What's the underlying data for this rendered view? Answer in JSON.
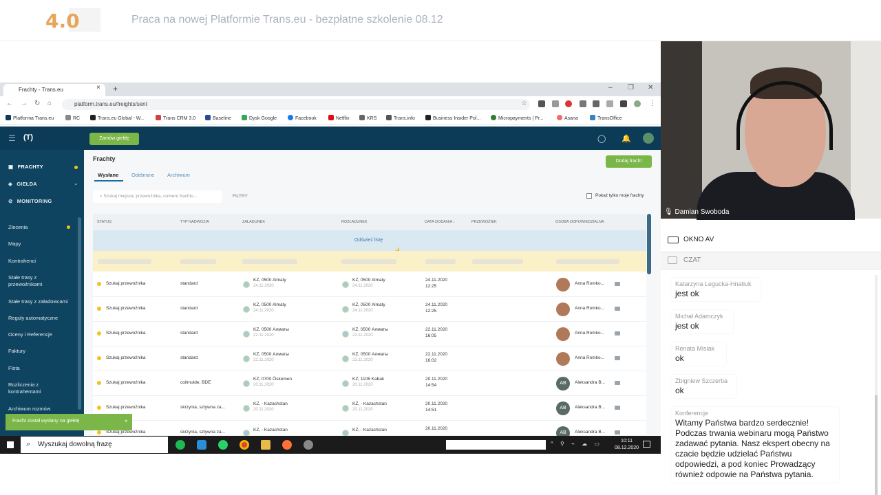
{
  "banner": {
    "logo": "4.0",
    "title": "Praca na nowej Platformie Trans.eu - bezpłatne szkolenie 08.12"
  },
  "browser": {
    "tab_title": "Frachty - Trans.eu",
    "url": "platform.trans.eu/freights/sent",
    "bookmarks": [
      "Platforma Trans.eu",
      "RC",
      "Trans.eu Global - W...",
      "Trans CRM 3.0",
      "Baseline",
      "Dysk Google",
      "Facebook",
      "Netflix",
      "KRS",
      "Trans.info",
      "Business Insider Pol...",
      "Micropayments | Pr...",
      "Asana",
      "TransOffice"
    ]
  },
  "app": {
    "logo": "(T)",
    "order_button": "Zamów giełdę",
    "sidebar_main": [
      "FRACHTY",
      "GIEŁDA",
      "MONITORING"
    ],
    "sidebar_sub": [
      "Zlecenia",
      "Mapy",
      "Kontrahenci",
      "Stałe trasy z przewoźnikami",
      "Stałe trasy z załadowcami",
      "Reguły automatyczne",
      "Oceny i Referencje",
      "Faktury",
      "Flota",
      "Rozliczenia z kontrahentami",
      "Archiwum rozmów"
    ],
    "page_title": "Frachty",
    "add_button": "Dodaj fracht",
    "tabs": [
      "Wysłane",
      "Odebrane",
      "Archiwum"
    ],
    "search_placeholder": "Szukaj miejsca, przewoźnika, numeru frachtu...",
    "filters": "FILTRY",
    "only_mine": "Pokaż tylko moje frachty",
    "columns": [
      "STATUS",
      "TYP NADWOZIA",
      "ZAŁADUNEK",
      "ROZŁADUNEK",
      "DATA DODANIA",
      "PRZEWOŹNIK",
      "OSOBA ODPOWIEDZIALNA"
    ],
    "refresh": "Odśwież listę",
    "rows": [
      {
        "status": "Szukaj przewoźnika",
        "body": "standard",
        "load": "KZ, 0500 Almaty",
        "load_date": "24.11.2020",
        "unload": "KZ, 0500 Almaty",
        "unload_date": "24.11.2020",
        "added": "24.11.2020",
        "time": "12:25",
        "person": "Anna Romko...",
        "avatar": ""
      },
      {
        "status": "Szukaj przewoźnika",
        "body": "standard",
        "load": "KZ, 0500 Almaty",
        "load_date": "24.11.2020",
        "unload": "KZ, 0500 Almaty",
        "unload_date": "24.11.2020",
        "added": "24.11.2020",
        "time": "12:25",
        "person": "Anna Romko...",
        "avatar": ""
      },
      {
        "status": "Szukaj przewoźnika",
        "body": "standard",
        "load": "KZ, 0500 Алматы",
        "load_date": "22.11.2020",
        "unload": "KZ, 0500 Алматы",
        "unload_date": "22.11.2020",
        "added": "22.11.2020",
        "time": "16:05",
        "person": "Anna Romko...",
        "avatar": ""
      },
      {
        "status": "Szukaj przewoźnika",
        "body": "standard",
        "load": "KZ, 0500 Алматы",
        "load_date": "22.11.2020",
        "unload": "KZ, 0500 Алматы",
        "unload_date": "22.11.2020",
        "added": "22.11.2020",
        "time": "16:02",
        "person": "Anna Romko...",
        "avatar": ""
      },
      {
        "status": "Szukaj przewoźnika",
        "body": "coilmulde, BDE",
        "load": "KZ, 0700 Öskemen",
        "load_date": "20.11.2020",
        "unload": "KZ, 1106 Kabak",
        "unload_date": "20.11.2020",
        "added": "20.11.2020",
        "time": "14:54",
        "person": "Aleksandra B...",
        "avatar": "AB"
      },
      {
        "status": "Szukaj przewoźnika",
        "body": "skrzynia, sztywna za...",
        "load": "KZ, - Kazachstan",
        "load_date": "20.11.2020",
        "unload": "KZ, - Kazachstan",
        "unload_date": "20.11.2020",
        "added": "20.11.2020",
        "time": "14:51",
        "person": "Aleksandra B...",
        "avatar": "AB"
      },
      {
        "status": "Szukaj przewoźnika",
        "body": "skrzynia, sztywna za...",
        "load": "KZ, - Kazachstan",
        "load_date": "",
        "unload": "KZ, - Kazachstan",
        "unload_date": "",
        "added": "20.11.2020",
        "time": "",
        "person": "Aleksandra B...",
        "avatar": "AB"
      }
    ],
    "toast": "Fracht został wysłany na giełdę"
  },
  "taskbar": {
    "search": "Wyszukaj dowolną frazę",
    "time": "10:11",
    "date": "08.12.2020"
  },
  "video": {
    "speaker": "Damian Swoboda"
  },
  "panel": {
    "av_label": "OKNO AV",
    "chat_label": "CZAT"
  },
  "chat": [
    {
      "author": "Katarzyna Legucka-Hnatiuk",
      "text": "jest ok"
    },
    {
      "author": "Michał Adamczyk",
      "text": "jest ok"
    },
    {
      "author": "Renata Misiak",
      "text": "ok"
    },
    {
      "author": "Zbigniew Szczerba",
      "text": "ok"
    },
    {
      "author": "Konferencje",
      "text": "Witamy Państwa bardzo serdecznie! Podczas trwania webinaru mogą Państwo zadawać pytania. Nasz ekspert obecny na czacie będzie udzielać Państwu odpowiedzi, a pod koniec Prowadzący również odpowie na Państwa pytania."
    }
  ],
  "colors": {
    "app_header": "#0b3b56",
    "sidebar": "#0f4460",
    "accent_green": "#7ab648",
    "status_yellow": "#f0c419"
  }
}
